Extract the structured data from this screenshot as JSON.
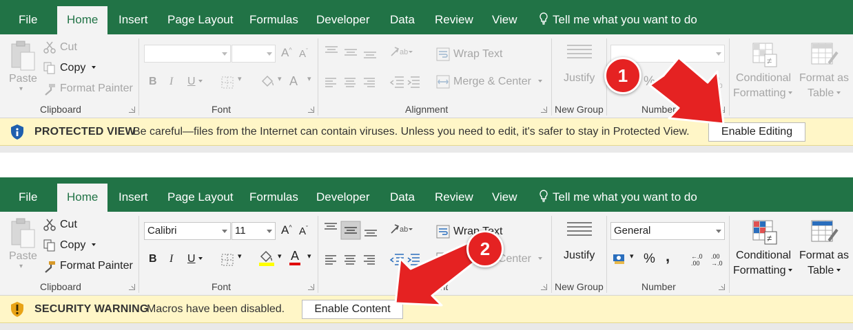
{
  "tabs": [
    "File",
    "Home",
    "Insert",
    "Page Layout",
    "Formulas",
    "Developer",
    "Data",
    "Review",
    "View"
  ],
  "tell_me": "Tell me what you want to do",
  "clipboard": {
    "paste": "Paste",
    "cut": "Cut",
    "copy": "Copy",
    "format_painter": "Format Painter",
    "label": "Clipboard"
  },
  "font": {
    "label": "Font",
    "bold": "B",
    "italic": "I",
    "underline": "U",
    "color_glyph": "A"
  },
  "alignment": {
    "label": "Alignment",
    "wrap_text": "Wrap Text",
    "merge_center": "Merge & Center"
  },
  "new_group": {
    "label": "New Group",
    "justify": "Justify"
  },
  "number": {
    "label": "Number",
    "percent": "%",
    "comma": ","
  },
  "styles": {
    "conditional_1": "Conditional",
    "conditional_2": "Formatting",
    "format_as_1": "Format as",
    "format_as_2": "Table"
  },
  "panel1": {
    "font_name": "",
    "font_size": "",
    "number_format": "",
    "bar_title": "PROTECTED VIEW",
    "bar_text": "Be careful—files from the Internet can contain viruses. Unless you need to edit, it's safer to stay in Protected View.",
    "bar_button": "Enable Editing",
    "callout": "1"
  },
  "panel2": {
    "font_name": "Calibri",
    "font_size": "11",
    "number_format": "General",
    "bar_title": "SECURITY WARNING",
    "bar_text": "Macros have been disabled.",
    "bar_button": "Enable Content",
    "callout": "2"
  },
  "colors": {
    "title_bar": "#217346",
    "message_bar": "#fff6c7",
    "callout_red": "#e52222",
    "shield_blue": "#1f5fae",
    "shield_amber": "#e8a317"
  }
}
